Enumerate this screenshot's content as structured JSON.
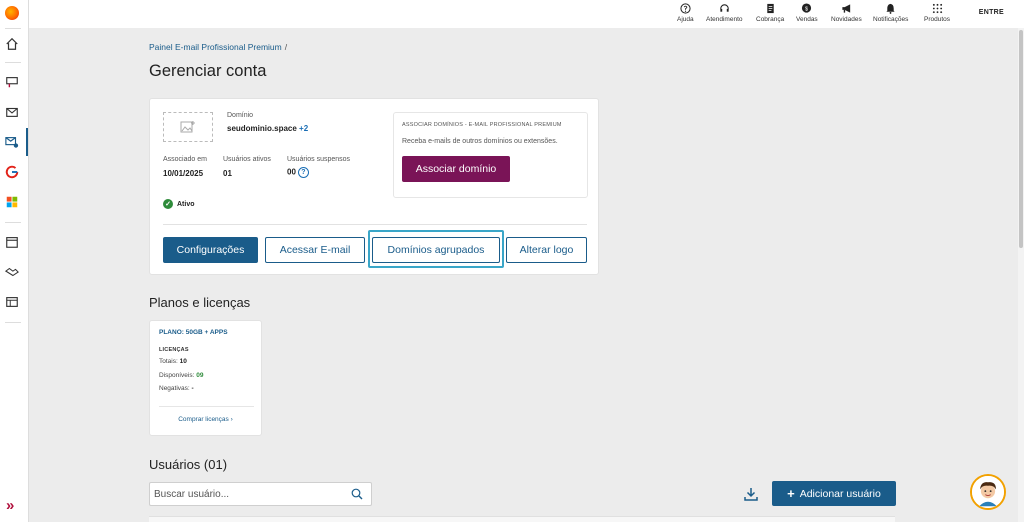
{
  "topbar": {
    "items": [
      {
        "label": "Ajuda",
        "icon": "help-icon"
      },
      {
        "label": "Atendimento",
        "icon": "headset-icon"
      },
      {
        "label": "Cobrança",
        "icon": "invoice-icon"
      },
      {
        "label": "Vendas",
        "icon": "money-bubble-icon"
      },
      {
        "label": "Novidades",
        "icon": "megaphone-icon"
      },
      {
        "label": "Notificações",
        "icon": "bell-icon"
      },
      {
        "label": "Produtos",
        "icon": "grid-icon"
      }
    ],
    "enter_label": "ENTRE"
  },
  "breadcrumb": {
    "item": "Painel E-mail Profissional Premium",
    "separator": "/"
  },
  "page_title": "Gerenciar conta",
  "account": {
    "domain_label": "Domínio",
    "domain_value": "seudominio.space",
    "domain_extra": "+2",
    "associated_label": "Associado em",
    "associated_value": "10/01/2025",
    "active_users_label": "Usuários ativos",
    "active_users_value": "01",
    "suspended_users_label": "Usuários suspensos",
    "suspended_users_value": "00",
    "help_glyph": "?",
    "status_label": "Ativo",
    "status_glyph": "✓"
  },
  "associate": {
    "title": "ASSOCIAR DOMÍNIOS - E-MAIL PROFISSIONAL PREMIUM",
    "description": "Receba e-mails de outros domínios ou extensões.",
    "button_label": "Associar domínio"
  },
  "actions": {
    "settings": "Configurações",
    "access_email": "Acessar E-mail",
    "grouped_domains": "Domínios agrupados",
    "change_logo": "Alterar logo"
  },
  "plans": {
    "section_title": "Planos e licenças",
    "plan_name": "PLANO: 50GB + APPS",
    "licenses_label": "LICENÇAS",
    "total_label": "Totais:",
    "total_value": "10",
    "available_label": "Disponíveis:",
    "available_value": "09",
    "negative_label": "Negativas:",
    "negative_value": "-",
    "buy_label": "Comprar licenças",
    "buy_chevron": "›"
  },
  "users": {
    "section_title": "Usuários (01)",
    "search_placeholder": "Buscar usuário...",
    "add_plus": "+",
    "add_label": "Adicionar usuário"
  },
  "rail": {
    "expand_glyph": "»"
  },
  "colors": {
    "primary": "#1a5c8a",
    "associate_button": "#7a1457",
    "success": "#2e8b3a",
    "focus": "#3aa6c8"
  }
}
